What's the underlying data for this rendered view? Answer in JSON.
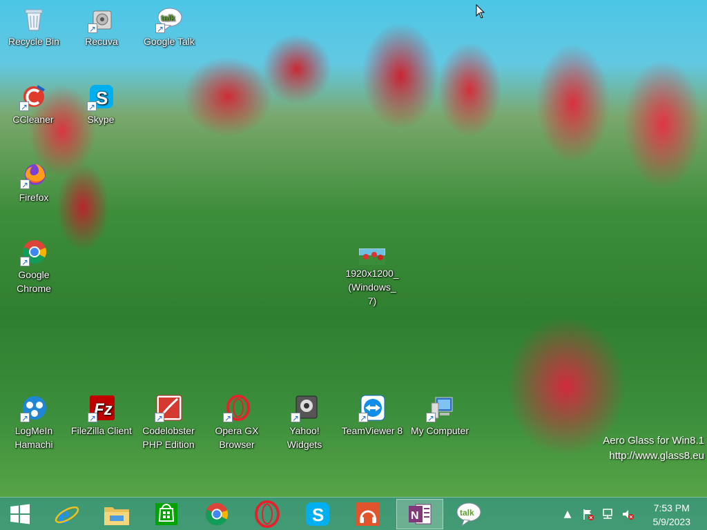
{
  "desktop": {
    "icons": [
      {
        "label": "Recycle Bin"
      },
      {
        "label": "Recuva"
      },
      {
        "label": "Google Talk"
      },
      {
        "label": "CCleaner"
      },
      {
        "label": "Skype"
      },
      {
        "label": "Firefox"
      },
      {
        "label": "Google Chrome"
      },
      {
        "label": "1920x1200_(Windows_7)"
      },
      {
        "label": "LogMeIn Hamachi"
      },
      {
        "label": "FileZilla Client"
      },
      {
        "label": "Codelobster PHP Edition"
      },
      {
        "label": "Opera GX Browser"
      },
      {
        "label": "Yahoo! Widgets"
      },
      {
        "label": "TeamViewer 8"
      },
      {
        "label": "My Computer"
      }
    ]
  },
  "watermark": {
    "line1": "Aero Glass for Win8.1",
    "line2": "http://www.glass8.eu"
  },
  "taskbar": {
    "pinned": [
      {
        "icon": "internet-explorer-icon"
      },
      {
        "icon": "file-explorer-icon"
      },
      {
        "icon": "store-icon"
      },
      {
        "icon": "chrome-icon"
      },
      {
        "icon": "opera-icon"
      },
      {
        "icon": "skype-icon"
      },
      {
        "icon": "music-icon"
      },
      {
        "icon": "onenote-icon"
      },
      {
        "icon": "google-talk-icon"
      }
    ],
    "tray": {
      "time": "7:53 PM",
      "date": "5/9/2023"
    }
  },
  "colors": {
    "taskbar": "#288c96",
    "ie_blue": "#1e90ff",
    "store_green": "#00a300",
    "onenote_purple": "#80397b"
  }
}
